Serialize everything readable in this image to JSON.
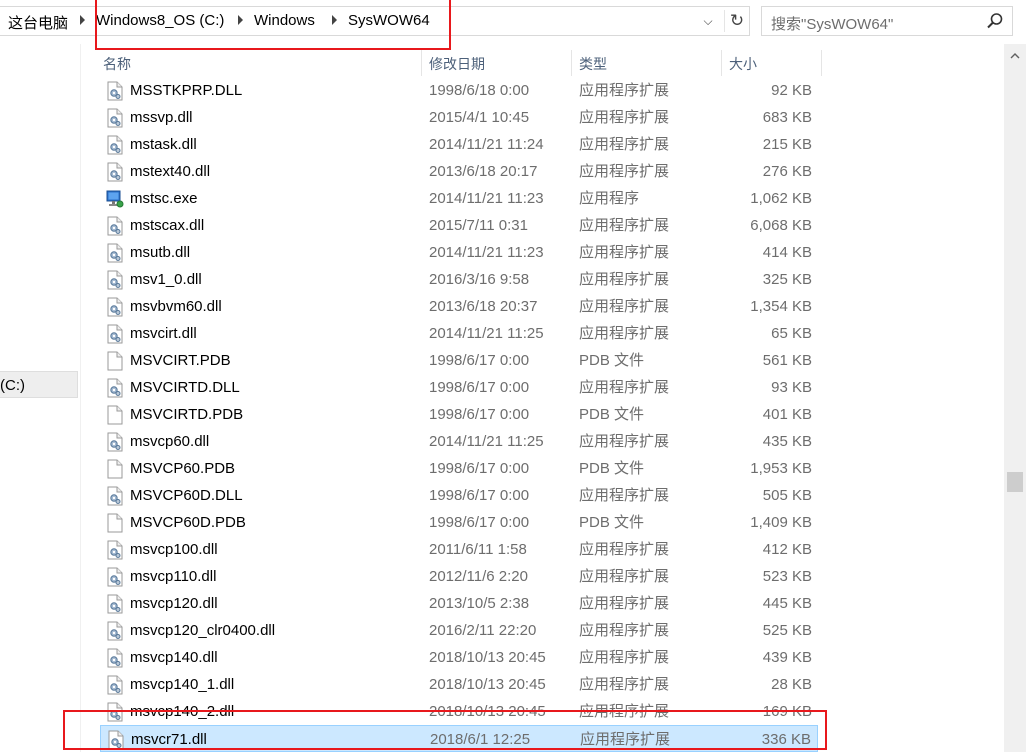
{
  "address": {
    "crumbs": [
      "这台电脑",
      "Windows8_OS (C:)",
      "Windows",
      "SysWOW64"
    ],
    "dropdown_glyph": "⌵",
    "refresh_glyph": "↻"
  },
  "search": {
    "placeholder": "搜索\"SysWOW64\""
  },
  "nav": {
    "drive_label": "(C:)"
  },
  "columns": {
    "name": "名称",
    "date": "修改日期",
    "type": "类型",
    "size": "大小"
  },
  "files": [
    {
      "name": "MSSTKPRP.DLL",
      "date": "1998/6/18 0:00",
      "type": "应用程序扩展",
      "size": "92 KB",
      "icon": "dll-icon"
    },
    {
      "name": "mssvp.dll",
      "date": "2015/4/1 10:45",
      "type": "应用程序扩展",
      "size": "683 KB",
      "icon": "dll-icon"
    },
    {
      "name": "mstask.dll",
      "date": "2014/11/21 11:24",
      "type": "应用程序扩展",
      "size": "215 KB",
      "icon": "dll-icon"
    },
    {
      "name": "mstext40.dll",
      "date": "2013/6/18 20:17",
      "type": "应用程序扩展",
      "size": "276 KB",
      "icon": "dll-icon"
    },
    {
      "name": "mstsc.exe",
      "date": "2014/11/21 11:23",
      "type": "应用程序",
      "size": "1,062 KB",
      "icon": "exe-icon"
    },
    {
      "name": "mstscax.dll",
      "date": "2015/7/11 0:31",
      "type": "应用程序扩展",
      "size": "6,068 KB",
      "icon": "dll-icon"
    },
    {
      "name": "msutb.dll",
      "date": "2014/11/21 11:23",
      "type": "应用程序扩展",
      "size": "414 KB",
      "icon": "dll-icon"
    },
    {
      "name": "msv1_0.dll",
      "date": "2016/3/16 9:58",
      "type": "应用程序扩展",
      "size": "325 KB",
      "icon": "dll-icon"
    },
    {
      "name": "msvbvm60.dll",
      "date": "2013/6/18 20:37",
      "type": "应用程序扩展",
      "size": "1,354 KB",
      "icon": "dll-icon"
    },
    {
      "name": "msvcirt.dll",
      "date": "2014/11/21 11:25",
      "type": "应用程序扩展",
      "size": "65 KB",
      "icon": "dll-icon"
    },
    {
      "name": "MSVCIRT.PDB",
      "date": "1998/6/17 0:00",
      "type": "PDB 文件",
      "size": "561 KB",
      "icon": "file-icon"
    },
    {
      "name": "MSVCIRTD.DLL",
      "date": "1998/6/17 0:00",
      "type": "应用程序扩展",
      "size": "93 KB",
      "icon": "dll-icon"
    },
    {
      "name": "MSVCIRTD.PDB",
      "date": "1998/6/17 0:00",
      "type": "PDB 文件",
      "size": "401 KB",
      "icon": "file-icon"
    },
    {
      "name": "msvcp60.dll",
      "date": "2014/11/21 11:25",
      "type": "应用程序扩展",
      "size": "435 KB",
      "icon": "dll-icon"
    },
    {
      "name": "MSVCP60.PDB",
      "date": "1998/6/17 0:00",
      "type": "PDB 文件",
      "size": "1,953 KB",
      "icon": "file-icon"
    },
    {
      "name": "MSVCP60D.DLL",
      "date": "1998/6/17 0:00",
      "type": "应用程序扩展",
      "size": "505 KB",
      "icon": "dll-icon"
    },
    {
      "name": "MSVCP60D.PDB",
      "date": "1998/6/17 0:00",
      "type": "PDB 文件",
      "size": "1,409 KB",
      "icon": "file-icon"
    },
    {
      "name": "msvcp100.dll",
      "date": "2011/6/11 1:58",
      "type": "应用程序扩展",
      "size": "412 KB",
      "icon": "dll-icon"
    },
    {
      "name": "msvcp110.dll",
      "date": "2012/11/6 2:20",
      "type": "应用程序扩展",
      "size": "523 KB",
      "icon": "dll-icon"
    },
    {
      "name": "msvcp120.dll",
      "date": "2013/10/5 2:38",
      "type": "应用程序扩展",
      "size": "445 KB",
      "icon": "dll-icon"
    },
    {
      "name": "msvcp120_clr0400.dll",
      "date": "2016/2/11 22:20",
      "type": "应用程序扩展",
      "size": "525 KB",
      "icon": "dll-icon"
    },
    {
      "name": "msvcp140.dll",
      "date": "2018/10/13 20:45",
      "type": "应用程序扩展",
      "size": "439 KB",
      "icon": "dll-icon"
    },
    {
      "name": "msvcp140_1.dll",
      "date": "2018/10/13 20:45",
      "type": "应用程序扩展",
      "size": "28 KB",
      "icon": "dll-icon"
    },
    {
      "name": "msvcp140_2.dll",
      "date": "2018/10/13 20:45",
      "type": "应用程序扩展",
      "size": "169 KB",
      "icon": "dll-icon"
    },
    {
      "name": "msvcr71.dll",
      "date": "2018/6/1 12:25",
      "type": "应用程序扩展",
      "size": "336 KB",
      "icon": "dll-icon",
      "selected": true
    }
  ],
  "colors": {
    "highlight": "#e8181c",
    "selection": "#cce8ff",
    "header_text": "#4c607a"
  }
}
